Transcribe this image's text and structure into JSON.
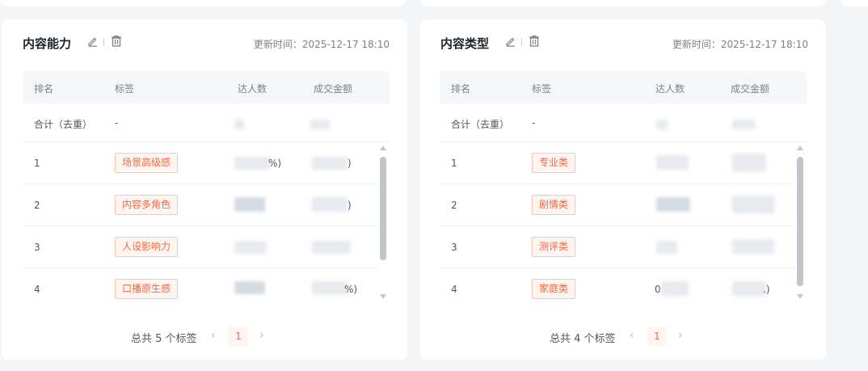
{
  "cards": [
    {
      "title": "内容能力",
      "update_time": "更新时间：2025-12-17 18:10",
      "columns": [
        "排名",
        "标签",
        "达人数",
        "成交金额"
      ],
      "total_row": {
        "label": "合计（去重）",
        "tag": "-"
      },
      "rows": [
        {
          "rank": "1",
          "tag": "场景高级感",
          "amount_suffix": "%)",
          "gmv_suffix": ")"
        },
        {
          "rank": "2",
          "tag": "内容多角色",
          "amount_suffix": "",
          "gmv_suffix": ")"
        },
        {
          "rank": "3",
          "tag": "人设影响力",
          "amount_suffix": "",
          "gmv_suffix": ""
        },
        {
          "rank": "4",
          "tag": "口播原生感",
          "amount_suffix": "",
          "gmv_suffix": "%)"
        }
      ],
      "pagination": {
        "total": "总共 5 个标签",
        "current": "1",
        "prev": "‹",
        "next": "›"
      }
    },
    {
      "title": "内容类型",
      "update_time": "更新时间：2025-12-17 18:10",
      "columns": [
        "排名",
        "标签",
        "达人数",
        "成交金额"
      ],
      "total_row": {
        "label": "合计（去重）",
        "tag": "-"
      },
      "rows": [
        {
          "rank": "1",
          "tag": "专业类",
          "amount_prefix": "",
          "gmv_suffix": ""
        },
        {
          "rank": "2",
          "tag": "剧情类",
          "amount_prefix": "",
          "gmv_suffix": ""
        },
        {
          "rank": "3",
          "tag": "测评类",
          "amount_prefix": "",
          "gmv_suffix": ""
        },
        {
          "rank": "4",
          "tag": "家庭类",
          "amount_prefix": "0",
          "gmv_suffix": ".)"
        }
      ],
      "pagination": {
        "total": "总共 4 个标签",
        "current": "1",
        "prev": "‹",
        "next": "›"
      }
    }
  ],
  "icons": {
    "edit": "edit-icon",
    "delete": "trash-icon",
    "scroll_up": "scroll-up-arrow-icon",
    "scroll_down": "scroll-down-arrow-icon"
  },
  "colors": {
    "tag_text": "#f26a45",
    "tag_bg": "#fff4ef",
    "tag_border": "#f7c7b4",
    "page_bg": "#f4f5f7"
  }
}
